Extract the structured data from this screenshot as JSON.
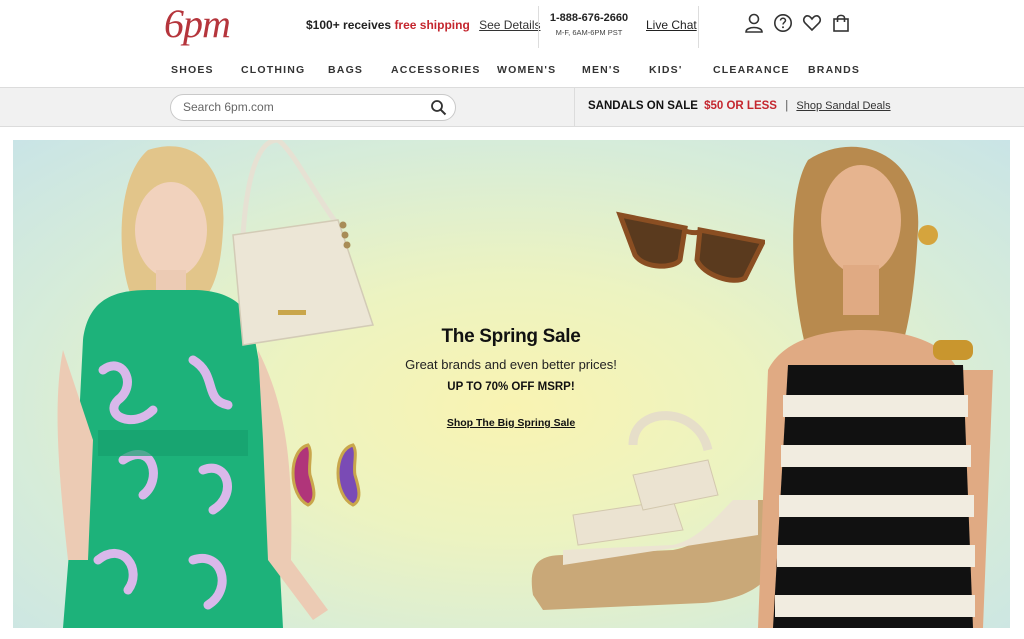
{
  "header": {
    "logo": "6pm",
    "promo_lead": "$100+ receives",
    "promo_free": "free shipping",
    "promo_details": "See Details",
    "phone": "1-888-676-2660",
    "phone_hours": "M-F, 6AM-6PM PST",
    "live_chat": "Live Chat",
    "icons": [
      "account-icon",
      "help-icon",
      "heart-icon",
      "bag-icon"
    ]
  },
  "nav": {
    "items": [
      "SHOES",
      "CLOTHING",
      "BAGS",
      "ACCESSORIES",
      "WOMEN'S",
      "MEN'S",
      "KIDS'",
      "CLEARANCE",
      "BRANDS"
    ]
  },
  "search": {
    "placeholder": "Search 6pm.com",
    "value": ""
  },
  "sandals_banner": {
    "headline": "SANDALS ON SALE",
    "price": "$50 OR LESS",
    "separator": "|",
    "link": "Shop Sandal Deals"
  },
  "hero": {
    "title": "The Spring Sale",
    "subtitle": "Great brands and even better prices!",
    "discount": "UP TO 70% OFF MSRP!",
    "cta": "Shop The Big Spring Sale"
  },
  "colors": {
    "brand": "#b5353c",
    "sale_red": "#c4262e"
  }
}
